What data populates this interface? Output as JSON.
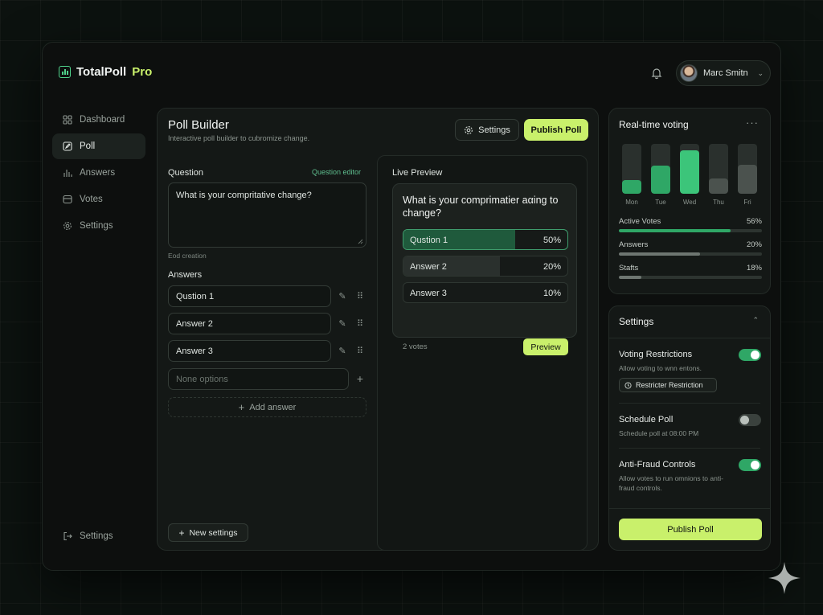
{
  "brand": {
    "name": "TotalPoll",
    "suffix": " Pro"
  },
  "user": {
    "name": "Marc Smitn"
  },
  "nav": {
    "items": [
      {
        "label": "Dashboard",
        "icon": "grid-icon"
      },
      {
        "label": "Poll",
        "icon": "edit-icon"
      },
      {
        "label": "Answers",
        "icon": "bar-chart-icon"
      },
      {
        "label": "Votes",
        "icon": "inbox-icon"
      },
      {
        "label": "Settings",
        "icon": "gear-icon"
      }
    ],
    "bottom": {
      "label": "Settings",
      "icon": "logout-icon"
    }
  },
  "builder": {
    "title": "Poll Builder",
    "subtitle": "Interactive poll builder to cubromize change.",
    "settings_label": "Settings",
    "publish_label": "Publish Poll",
    "question_label": "Question",
    "question_editor_link": "Question editor",
    "question_value": "What is your compritative change?",
    "question_hint": "Eod creation",
    "answers_label": "Answers",
    "answers": [
      "Qustion 1",
      "Answer 2",
      "Answer 3"
    ],
    "new_option_placeholder": "None options",
    "add_answer_label": "Add answer",
    "new_settings_label": "New settings"
  },
  "preview": {
    "title": "Live Preview",
    "question": "What is your comprimatier aαing to change?",
    "options": [
      {
        "label": "Qustion 1",
        "percent": "50%",
        "fraction": 0.68,
        "selected": true
      },
      {
        "label": "Answer 2",
        "percent": "20%",
        "fraction": 0.59,
        "selected": false
      },
      {
        "label": "Answer 3",
        "percent": "10%",
        "fraction": 0.0,
        "selected": false
      }
    ],
    "votes": "2 votes",
    "preview_label": "Preview"
  },
  "realtime": {
    "title": "Real-time voting",
    "more": "···",
    "bars": [
      {
        "day": "Mon",
        "level": 0.27,
        "color": "#2fa766"
      },
      {
        "day": "Tue",
        "level": 0.56,
        "color": "#2fa766"
      },
      {
        "day": "Wed",
        "level": 0.87,
        "color": "#3cc57a"
      },
      {
        "day": "Thu",
        "level": 0.3,
        "color": "#4b524e"
      },
      {
        "day": "Fri",
        "level": 0.58,
        "color": "#4b524e"
      }
    ],
    "metrics": [
      {
        "label": "Active Votes",
        "value": "56%",
        "fraction": 0.78,
        "color": "#2fa766"
      },
      {
        "label": "Answers",
        "value": "20%",
        "fraction": 0.57,
        "color": "#6e7671"
      },
      {
        "label": "Stafts",
        "value": "18%",
        "fraction": 0.16,
        "color": "#6e7671"
      }
    ]
  },
  "settings": {
    "title": "Settings",
    "items": [
      {
        "title": "Voting Restrictions",
        "desc": "Allow voting to wnn entons.",
        "on": true
      },
      {
        "title": "Schedule Poll",
        "desc": "Schedule poll at 08:00 PM",
        "on": false
      },
      {
        "title": "Anti-Fraud Controls",
        "desc": "Allow votes to run omnions to anti-fraud controls.",
        "on": true
      }
    ],
    "chip_label": "Restricter Restriction",
    "publish_label": "Publish Poll"
  }
}
